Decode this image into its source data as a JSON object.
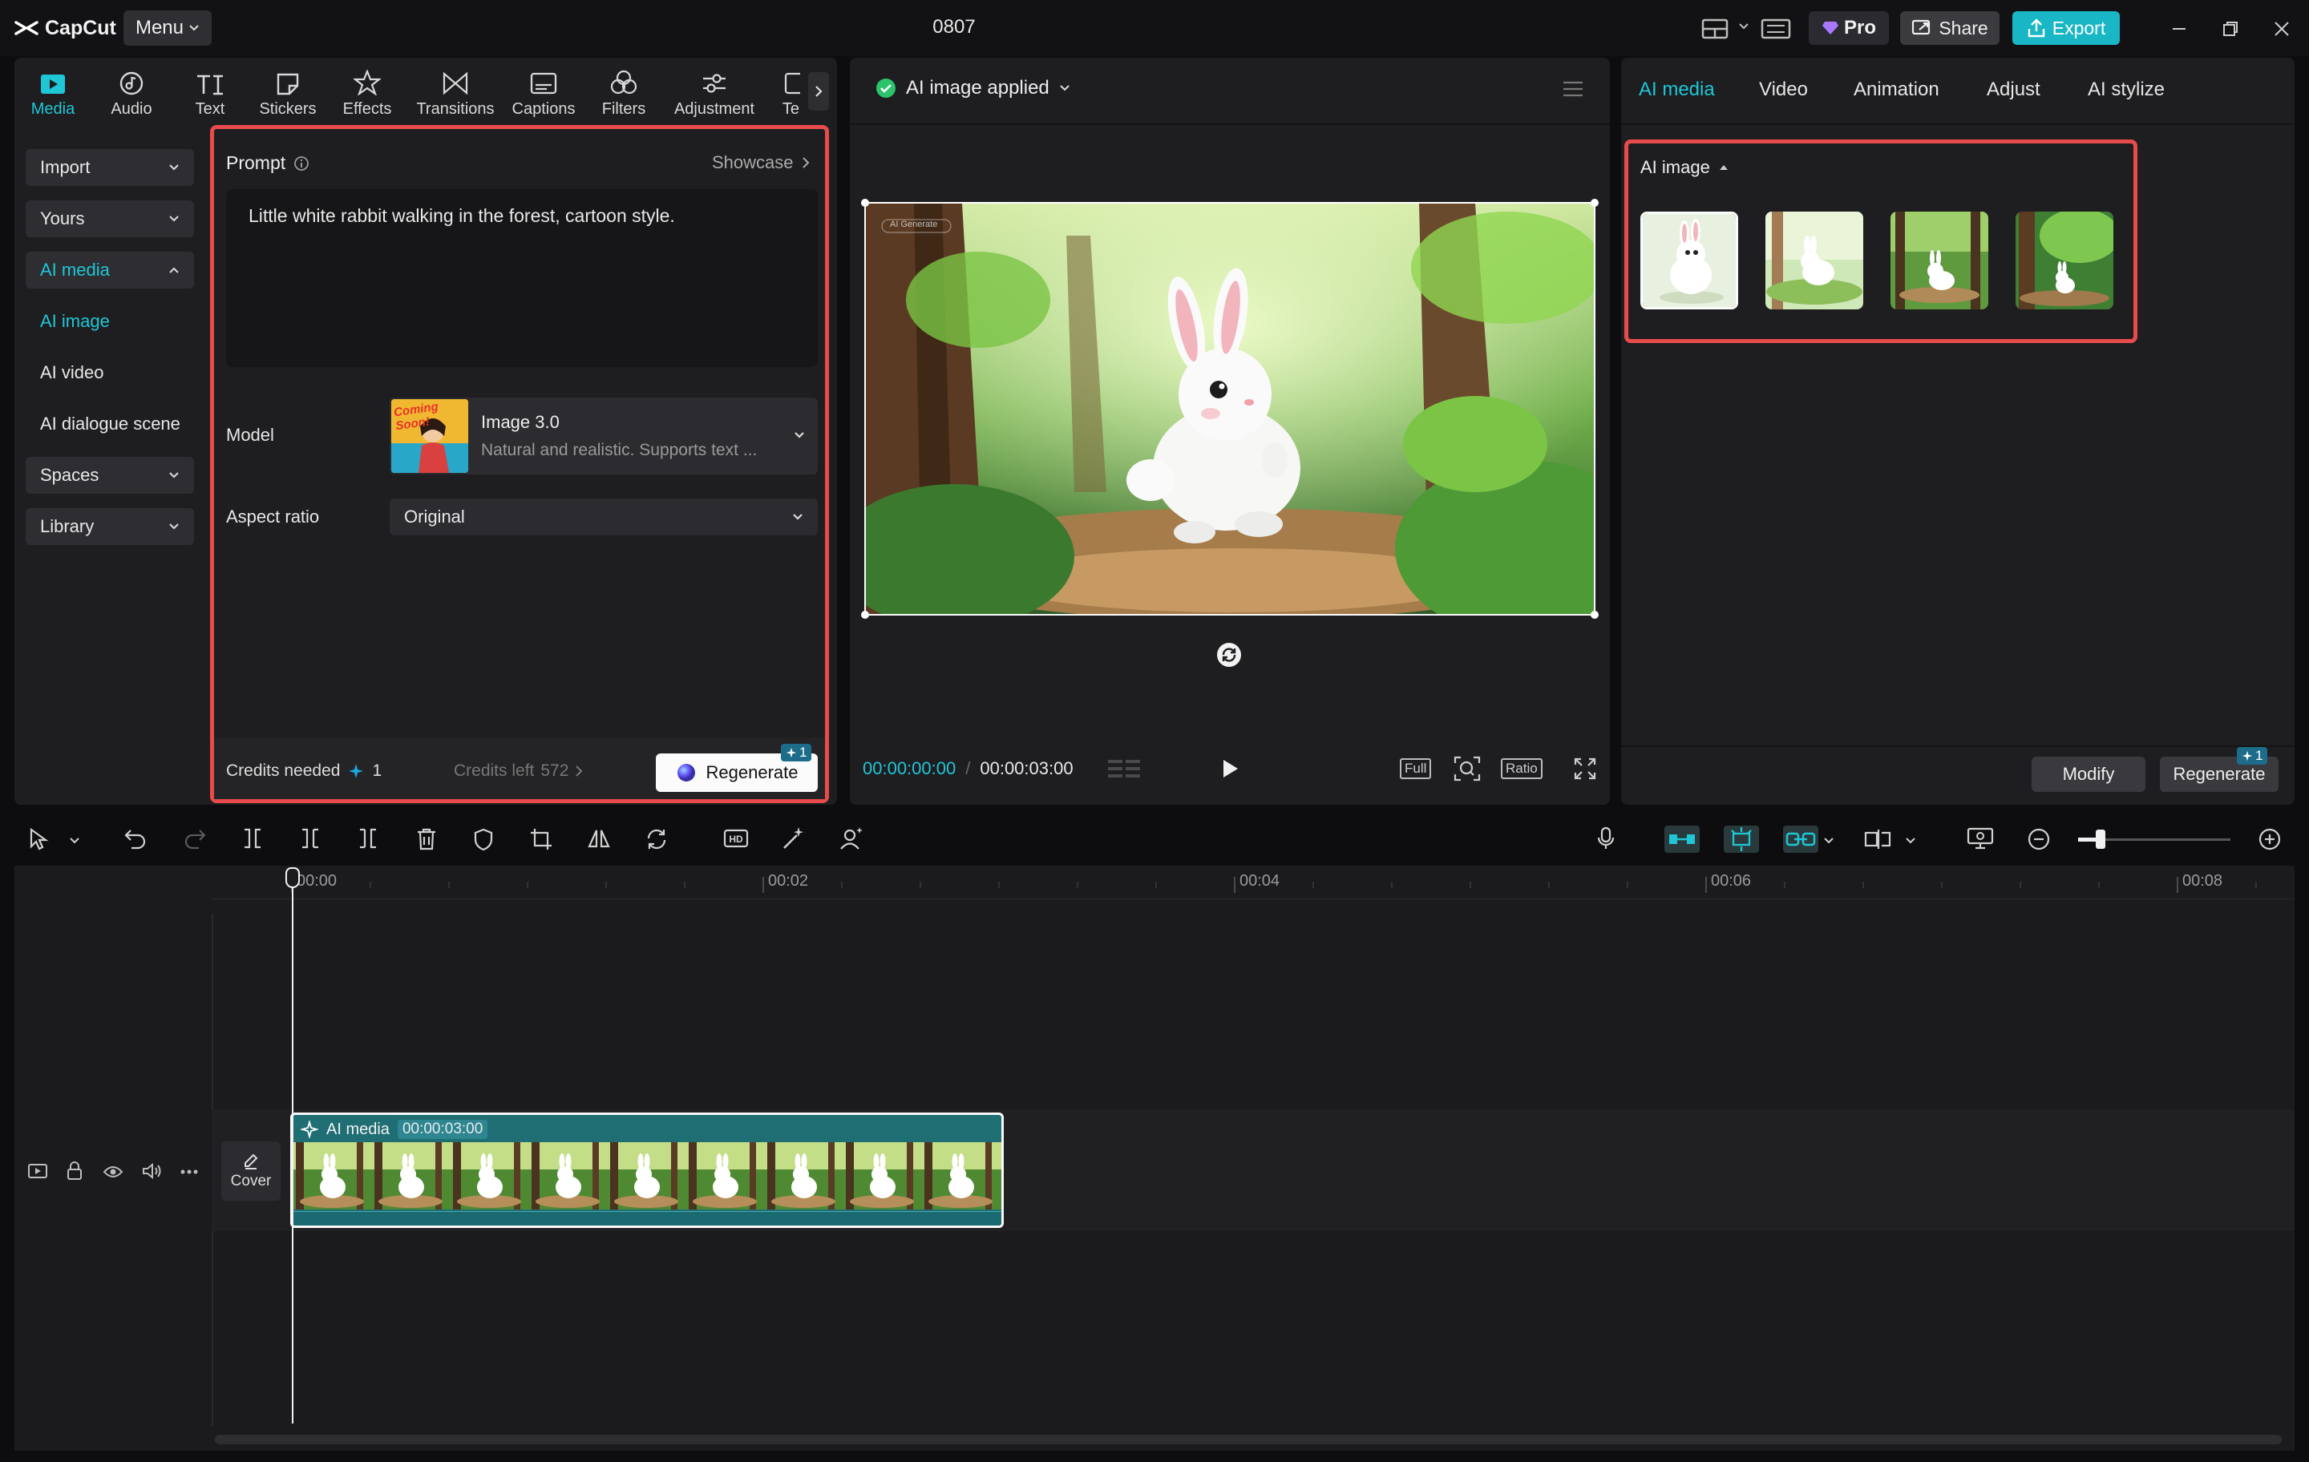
{
  "app": {
    "name": "CapCut",
    "menu_label": "Menu",
    "project_title": "0807"
  },
  "titlebar": {
    "pro_label": "Pro",
    "share_label": "Share",
    "export_label": "Export"
  },
  "colors": {
    "accent": "#1fc6d6",
    "export": "#19b7c6",
    "highlight_box": "#e84b4b"
  },
  "tool_tabs": [
    {
      "label": "Media",
      "icon": "media-icon",
      "active": true
    },
    {
      "label": "Audio",
      "icon": "audio-icon"
    },
    {
      "label": "Text",
      "icon": "text-icon"
    },
    {
      "label": "Stickers",
      "icon": "stickers-icon"
    },
    {
      "label": "Effects",
      "icon": "effects-icon"
    },
    {
      "label": "Transitions",
      "icon": "transitions-icon"
    },
    {
      "label": "Captions",
      "icon": "captions-icon"
    },
    {
      "label": "Filters",
      "icon": "filters-icon"
    },
    {
      "label": "Adjustment",
      "icon": "adjustment-icon"
    },
    {
      "label": "Ten",
      "icon": "templates-icon"
    }
  ],
  "left_nav": {
    "import": "Import",
    "yours": "Yours",
    "ai_media": "AI media",
    "ai_image": "AI image",
    "ai_video": "AI video",
    "ai_dialogue": "AI dialogue scene",
    "spaces": "Spaces",
    "library": "Library"
  },
  "ai_form": {
    "prompt_label": "Prompt",
    "showcase_label": "Showcase",
    "prompt_text": "Little white rabbit walking in the forest, cartoon style.",
    "model_label": "Model",
    "model_name": "Image 3.0",
    "model_desc": "Natural and realistic. Supports text ...",
    "model_thumb_text": "Coming Soon!",
    "ratio_label": "Aspect ratio",
    "ratio_value": "Original",
    "credits_needed_label": "Credits needed",
    "credits_needed": "1",
    "credits_left_label": "Credits left",
    "credits_left": "572",
    "regenerate_label": "Regenerate",
    "regenerate_badge": "1"
  },
  "preview": {
    "status": "AI image applied",
    "watermark": "AI Generate",
    "time_current": "00:00:00:00",
    "time_separator": "/",
    "time_total": "00:00:03:00",
    "full_label": "Full",
    "ratio_label": "Ratio"
  },
  "right_panel": {
    "tabs": [
      "AI media",
      "Video",
      "Animation",
      "Adjust",
      "AI stylize"
    ],
    "section_title": "AI image",
    "thumb_count": 4,
    "modify_label": "Modify",
    "regenerate_label": "Regenerate",
    "regenerate_badge": "1"
  },
  "timeline": {
    "ruler": [
      "00:00",
      "00:02",
      "00:04",
      "00:06",
      "00:08"
    ],
    "cover_label": "Cover",
    "clip_label": "AI media",
    "clip_time": "00:00:03:00"
  }
}
